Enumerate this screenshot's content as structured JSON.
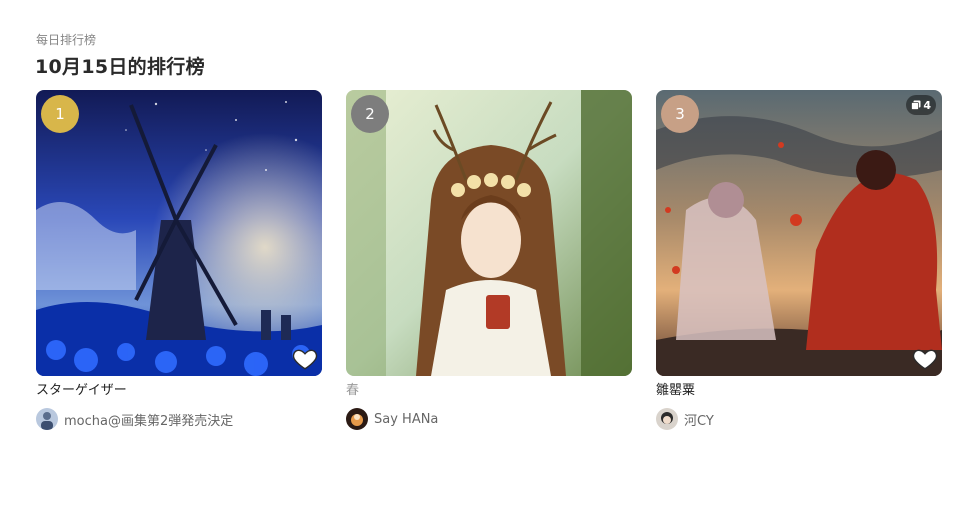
{
  "section": {
    "subtitle": "每日排行榜",
    "title": "10月15日的排行榜"
  },
  "ranking": [
    {
      "rank": "1",
      "title": "スターゲイザー",
      "author": "mocha@画集第2弾発売決定",
      "rank_color": "#d8b64a",
      "bookmark_icon": "heart-icon"
    },
    {
      "rank": "2",
      "title": "春",
      "author": "Say HANa",
      "rank_color": "#7d7d7d",
      "bookmark_icon": "heart-icon"
    },
    {
      "rank": "3",
      "title": "雛罌粟",
      "author": "河CY",
      "page_count": "4",
      "rank_color": "#c7a086",
      "bookmark_icon": "heart-icon"
    }
  ]
}
